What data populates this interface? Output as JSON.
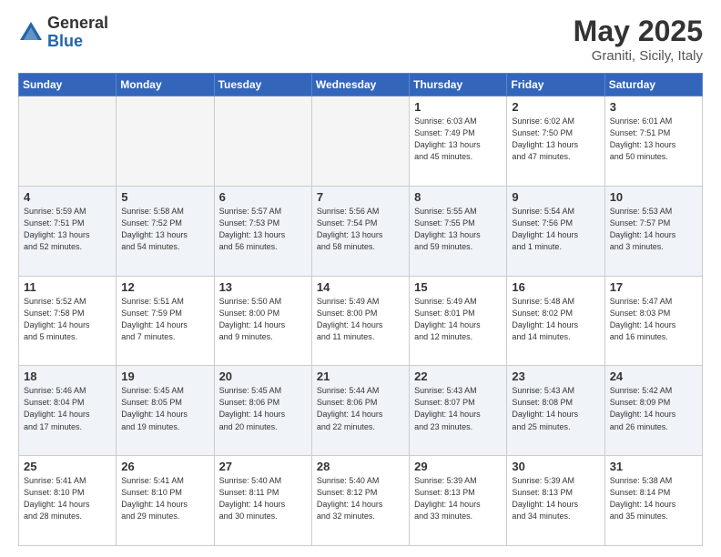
{
  "logo": {
    "general": "General",
    "blue": "Blue"
  },
  "title": "May 2025",
  "subtitle": "Graniti, Sicily, Italy",
  "days_of_week": [
    "Sunday",
    "Monday",
    "Tuesday",
    "Wednesday",
    "Thursday",
    "Friday",
    "Saturday"
  ],
  "weeks": [
    [
      {
        "day": "",
        "info": ""
      },
      {
        "day": "",
        "info": ""
      },
      {
        "day": "",
        "info": ""
      },
      {
        "day": "",
        "info": ""
      },
      {
        "day": "1",
        "info": "Sunrise: 6:03 AM\nSunset: 7:49 PM\nDaylight: 13 hours\nand 45 minutes."
      },
      {
        "day": "2",
        "info": "Sunrise: 6:02 AM\nSunset: 7:50 PM\nDaylight: 13 hours\nand 47 minutes."
      },
      {
        "day": "3",
        "info": "Sunrise: 6:01 AM\nSunset: 7:51 PM\nDaylight: 13 hours\nand 50 minutes."
      }
    ],
    [
      {
        "day": "4",
        "info": "Sunrise: 5:59 AM\nSunset: 7:51 PM\nDaylight: 13 hours\nand 52 minutes."
      },
      {
        "day": "5",
        "info": "Sunrise: 5:58 AM\nSunset: 7:52 PM\nDaylight: 13 hours\nand 54 minutes."
      },
      {
        "day": "6",
        "info": "Sunrise: 5:57 AM\nSunset: 7:53 PM\nDaylight: 13 hours\nand 56 minutes."
      },
      {
        "day": "7",
        "info": "Sunrise: 5:56 AM\nSunset: 7:54 PM\nDaylight: 13 hours\nand 58 minutes."
      },
      {
        "day": "8",
        "info": "Sunrise: 5:55 AM\nSunset: 7:55 PM\nDaylight: 13 hours\nand 59 minutes."
      },
      {
        "day": "9",
        "info": "Sunrise: 5:54 AM\nSunset: 7:56 PM\nDaylight: 14 hours\nand 1 minute."
      },
      {
        "day": "10",
        "info": "Sunrise: 5:53 AM\nSunset: 7:57 PM\nDaylight: 14 hours\nand 3 minutes."
      }
    ],
    [
      {
        "day": "11",
        "info": "Sunrise: 5:52 AM\nSunset: 7:58 PM\nDaylight: 14 hours\nand 5 minutes."
      },
      {
        "day": "12",
        "info": "Sunrise: 5:51 AM\nSunset: 7:59 PM\nDaylight: 14 hours\nand 7 minutes."
      },
      {
        "day": "13",
        "info": "Sunrise: 5:50 AM\nSunset: 8:00 PM\nDaylight: 14 hours\nand 9 minutes."
      },
      {
        "day": "14",
        "info": "Sunrise: 5:49 AM\nSunset: 8:00 PM\nDaylight: 14 hours\nand 11 minutes."
      },
      {
        "day": "15",
        "info": "Sunrise: 5:49 AM\nSunset: 8:01 PM\nDaylight: 14 hours\nand 12 minutes."
      },
      {
        "day": "16",
        "info": "Sunrise: 5:48 AM\nSunset: 8:02 PM\nDaylight: 14 hours\nand 14 minutes."
      },
      {
        "day": "17",
        "info": "Sunrise: 5:47 AM\nSunset: 8:03 PM\nDaylight: 14 hours\nand 16 minutes."
      }
    ],
    [
      {
        "day": "18",
        "info": "Sunrise: 5:46 AM\nSunset: 8:04 PM\nDaylight: 14 hours\nand 17 minutes."
      },
      {
        "day": "19",
        "info": "Sunrise: 5:45 AM\nSunset: 8:05 PM\nDaylight: 14 hours\nand 19 minutes."
      },
      {
        "day": "20",
        "info": "Sunrise: 5:45 AM\nSunset: 8:06 PM\nDaylight: 14 hours\nand 20 minutes."
      },
      {
        "day": "21",
        "info": "Sunrise: 5:44 AM\nSunset: 8:06 PM\nDaylight: 14 hours\nand 22 minutes."
      },
      {
        "day": "22",
        "info": "Sunrise: 5:43 AM\nSunset: 8:07 PM\nDaylight: 14 hours\nand 23 minutes."
      },
      {
        "day": "23",
        "info": "Sunrise: 5:43 AM\nSunset: 8:08 PM\nDaylight: 14 hours\nand 25 minutes."
      },
      {
        "day": "24",
        "info": "Sunrise: 5:42 AM\nSunset: 8:09 PM\nDaylight: 14 hours\nand 26 minutes."
      }
    ],
    [
      {
        "day": "25",
        "info": "Sunrise: 5:41 AM\nSunset: 8:10 PM\nDaylight: 14 hours\nand 28 minutes."
      },
      {
        "day": "26",
        "info": "Sunrise: 5:41 AM\nSunset: 8:10 PM\nDaylight: 14 hours\nand 29 minutes."
      },
      {
        "day": "27",
        "info": "Sunrise: 5:40 AM\nSunset: 8:11 PM\nDaylight: 14 hours\nand 30 minutes."
      },
      {
        "day": "28",
        "info": "Sunrise: 5:40 AM\nSunset: 8:12 PM\nDaylight: 14 hours\nand 32 minutes."
      },
      {
        "day": "29",
        "info": "Sunrise: 5:39 AM\nSunset: 8:13 PM\nDaylight: 14 hours\nand 33 minutes."
      },
      {
        "day": "30",
        "info": "Sunrise: 5:39 AM\nSunset: 8:13 PM\nDaylight: 14 hours\nand 34 minutes."
      },
      {
        "day": "31",
        "info": "Sunrise: 5:38 AM\nSunset: 8:14 PM\nDaylight: 14 hours\nand 35 minutes."
      }
    ]
  ]
}
